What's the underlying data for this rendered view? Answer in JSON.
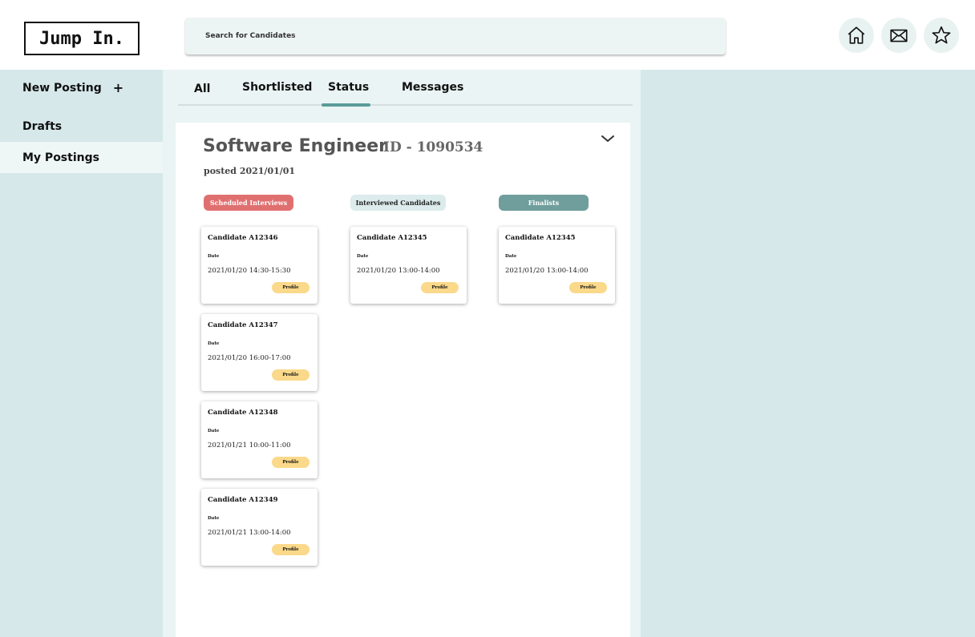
{
  "header": {
    "logo": "Jump In.",
    "search_placeholder": "Search for Candidates",
    "icons": [
      "home-icon",
      "mail-icon",
      "star-icon"
    ]
  },
  "sidebar": {
    "items": [
      {
        "label": "New Posting",
        "suffix": "+"
      },
      {
        "label": "Drafts"
      },
      {
        "label": "My Postings",
        "active": true
      }
    ]
  },
  "tabs": [
    {
      "label": "All"
    },
    {
      "label": "Shortlisted"
    },
    {
      "label": "Status",
      "active": true
    },
    {
      "label": "Messages"
    }
  ],
  "posting": {
    "title": "Software Engineer",
    "id_label": "ID - 1090534",
    "posted": "posted 2021/01/01"
  },
  "columns": [
    {
      "title": "Scheduled Interviews",
      "color": "#e07070",
      "cards": [
        {
          "name": "Candidate A12346",
          "date_label": "Date",
          "date": "2021/01/20 14:30-15:30",
          "button": "Profile"
        },
        {
          "name": "Candidate A12347",
          "date_label": "Date",
          "date": "2021/01/20 16:00-17:00",
          "button": "Profile"
        },
        {
          "name": "Candidate A12348",
          "date_label": "Date",
          "date": "2021/01/21 10:00-11:00",
          "button": "Profile"
        },
        {
          "name": "Candidate A12349",
          "date_label": "Date",
          "date": "2021/01/21 13:00-14:00",
          "button": "Profile"
        }
      ]
    },
    {
      "title": "Interviewed Candidates",
      "color": "#dcebeb",
      "cards": [
        {
          "name": "Candidate A12345",
          "date_label": "Date",
          "date": "2021/01/20 13:00-14:00",
          "button": "Profile"
        }
      ]
    },
    {
      "title": "Finalists",
      "color": "#6f9e9c",
      "cards": [
        {
          "name": "Candidate A12345",
          "date_label": "Date",
          "date": "2021/01/20 13:00-14:00",
          "button": "Profile"
        }
      ]
    }
  ],
  "colors": {
    "accent": "#5b9c9a",
    "sidebar_bg": "#d6e8ea",
    "profile_button": "#fbd98a"
  }
}
